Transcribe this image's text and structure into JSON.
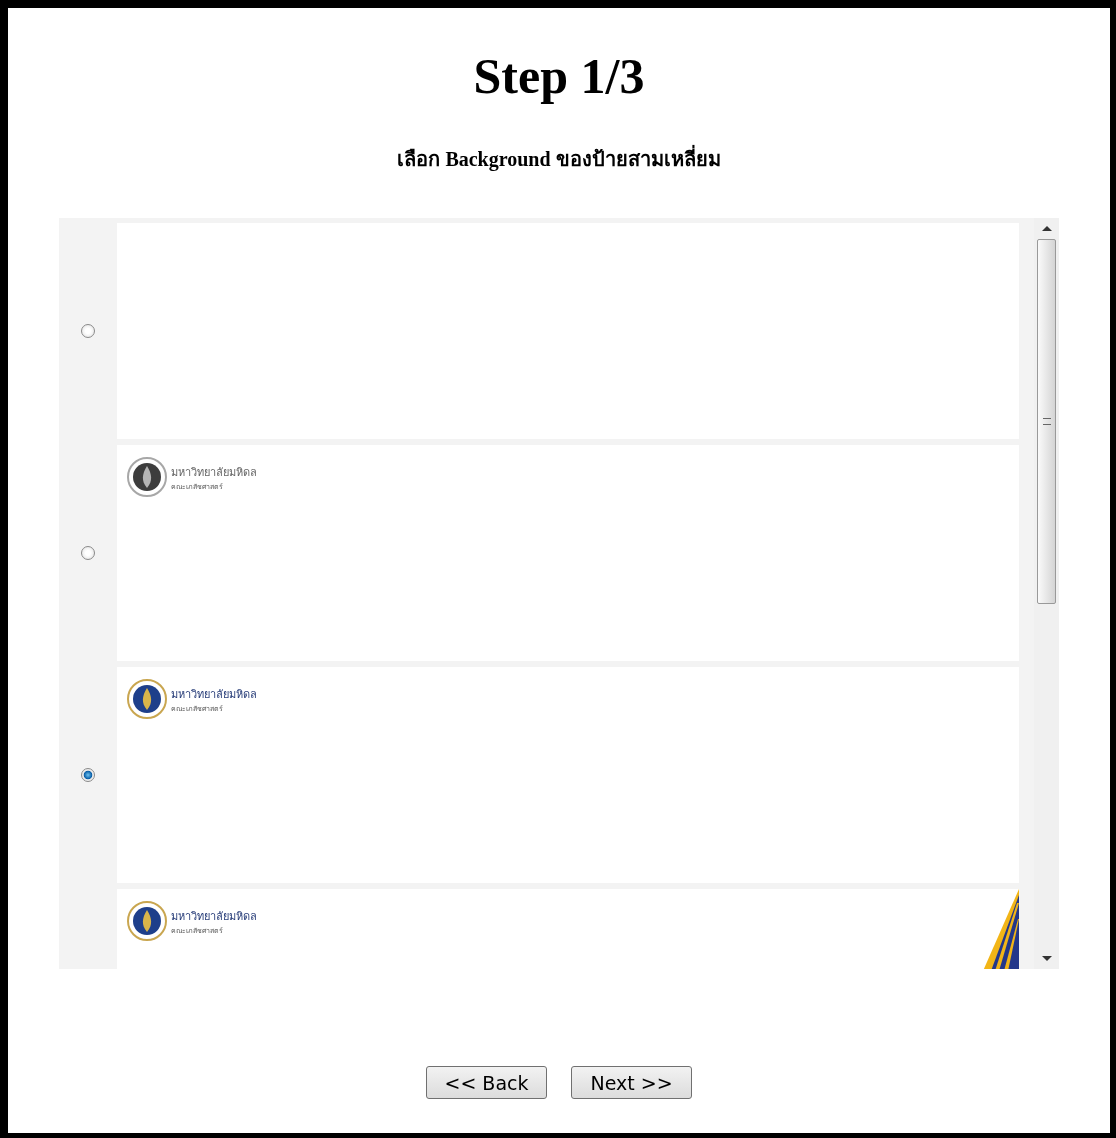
{
  "title": "Step 1/3",
  "subtitle": "เลือก Background ของป้ายสามเหลี่ยม",
  "backgrounds": [
    {
      "kind": "blank",
      "selected": false
    },
    {
      "kind": "grey-logo",
      "selected": false,
      "logo_name": "มหาวิทยาลัยมหิดล",
      "logo_faculty": "คณะเภสัชศาสตร์"
    },
    {
      "kind": "logo",
      "selected": true,
      "logo_name": "มหาวิทยาลัยมหิดล",
      "logo_faculty": "คณะเภสัชศาสตร์"
    },
    {
      "kind": "logo-stripes",
      "logo_name": "มหาวิทยาลัยมหิดล",
      "logo_faculty": "คณะเภสัชศาสตร์"
    }
  ],
  "buttons": [
    "<< Back",
    "Next >>"
  ]
}
